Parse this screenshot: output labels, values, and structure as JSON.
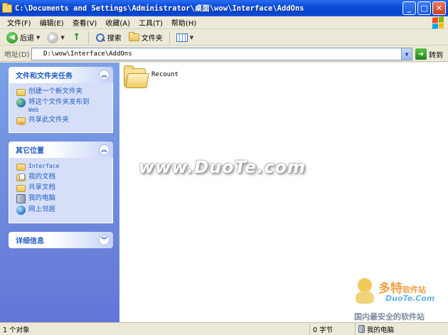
{
  "window": {
    "title": "C:\\Documents and Settings\\Administrator\\桌面\\wow\\Interface\\AddOns",
    "minimize": "_",
    "maximize": "□",
    "close": "✕"
  },
  "menu": [
    "文件(F)",
    "编辑(E)",
    "查看(V)",
    "收藏(A)",
    "工具(T)",
    "帮助(H)"
  ],
  "toolbar": {
    "back": "后退",
    "search": "搜索",
    "folders": "文件夹"
  },
  "address": {
    "label": "地址(D)",
    "value": "D:\\wow\\Interface\\AddOns",
    "go": "转到"
  },
  "taskpane": {
    "panels": [
      {
        "title": "文件和文件夹任务",
        "items": [
          {
            "label": "创建一个新文件夹",
            "icon": "new-folder-icon"
          },
          {
            "label": "将这个文件夹发布到",
            "label2": "Web",
            "icon": "globe-icon"
          },
          {
            "label": "共享此文件夹",
            "icon": "share-folder-icon"
          }
        ]
      },
      {
        "title": "其它位置",
        "items": [
          {
            "label": "Interface",
            "icon": "folder-icon"
          },
          {
            "label": "我的文档",
            "icon": "my-documents-icon"
          },
          {
            "label": "共享文档",
            "icon": "shared-documents-icon"
          },
          {
            "label": "我的电脑",
            "icon": "my-computer-icon"
          },
          {
            "label": "网上邻居",
            "icon": "network-icon"
          }
        ]
      },
      {
        "title": "详细信息",
        "items": []
      }
    ]
  },
  "content": {
    "items": [
      {
        "name": "Recount",
        "type": "folder"
      }
    ],
    "watermark": "www.DuoTe.com",
    "logo": {
      "brand": "多特",
      "brand_small": "软件站",
      "domain": "DuoTe.Com",
      "slogan": "国内最安全的软件站"
    }
  },
  "status": {
    "objects": "1 个对象",
    "size": "0 字节",
    "location": "我的电脑"
  }
}
